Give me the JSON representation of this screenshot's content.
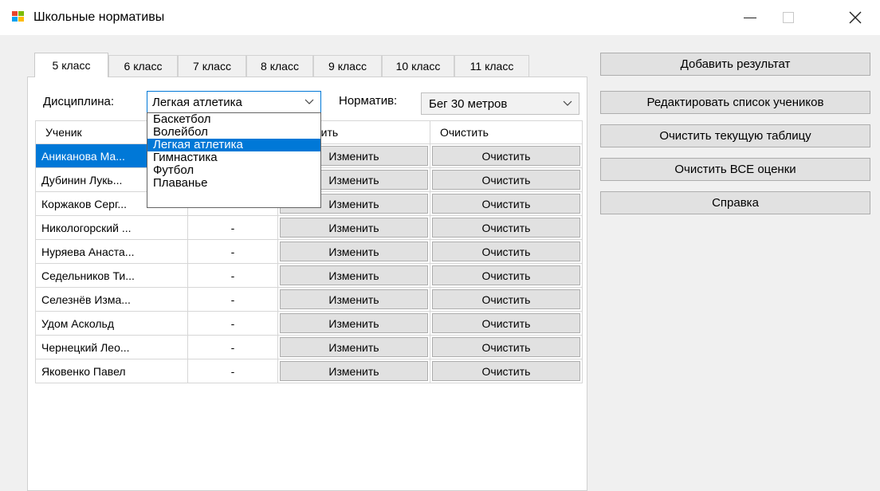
{
  "window": {
    "title": "Школьные нормативы",
    "icon": "winforms-app-icon"
  },
  "tabs": [
    {
      "label": "5 класс",
      "active": true
    },
    {
      "label": "6 класс",
      "active": false
    },
    {
      "label": "7 класс",
      "active": false
    },
    {
      "label": "8 класс",
      "active": false
    },
    {
      "label": "9 класс",
      "active": false
    },
    {
      "label": "10 класс",
      "active": false
    },
    {
      "label": "11 класс",
      "active": false
    }
  ],
  "filters": {
    "discipline_label": "Дисциплина:",
    "discipline_value": "Легкая атлетика",
    "norm_label": "Норматив:",
    "norm_value": "Бег 30 метров"
  },
  "dropdown": {
    "options": [
      "Баскетбол",
      "Волейбол",
      "Легкая атлетика",
      "Гимнастика",
      "Футбол",
      "Плаванье"
    ],
    "selected": "Легкая атлетика"
  },
  "table": {
    "headers": [
      "Ученик",
      "",
      "Изменить",
      "Очистить"
    ],
    "rows": [
      {
        "name": "Аниканова Ма...",
        "score": "-",
        "edit": "Изменить",
        "clear": "Очистить",
        "selected": true
      },
      {
        "name": "Дубинин Лукь...",
        "score": "-",
        "edit": "Изменить",
        "clear": "Очистить"
      },
      {
        "name": "Коржаков Серг...",
        "score": "-",
        "edit": "Изменить",
        "clear": "Очистить"
      },
      {
        "name": "Никологорский ...",
        "score": "-",
        "edit": "Изменить",
        "clear": "Очистить"
      },
      {
        "name": "Нуряева Анаста...",
        "score": "-",
        "edit": "Изменить",
        "clear": "Очистить"
      },
      {
        "name": "Седельников Ти...",
        "score": "-",
        "edit": "Изменить",
        "clear": "Очистить"
      },
      {
        "name": "Селезнёв Изма...",
        "score": "-",
        "edit": "Изменить",
        "clear": "Очистить"
      },
      {
        "name": "Удом Аскольд",
        "score": "-",
        "edit": "Изменить",
        "clear": "Очистить"
      },
      {
        "name": "Чернецкий Лео...",
        "score": "-",
        "edit": "Изменить",
        "clear": "Очистить"
      },
      {
        "name": "Яковенко Павел",
        "score": "-",
        "edit": "Изменить",
        "clear": "Очистить"
      }
    ]
  },
  "actions": {
    "add_result": "Добавить результат",
    "edit_students": "Редактировать список учеников",
    "clear_table": "Очистить текущую таблицу",
    "clear_all": "Очистить ВСЕ оценки",
    "help": "Справка"
  },
  "colors": {
    "accent": "#0078d7",
    "window_bg": "#f0f0f0",
    "button_bg": "#e1e1e1"
  }
}
